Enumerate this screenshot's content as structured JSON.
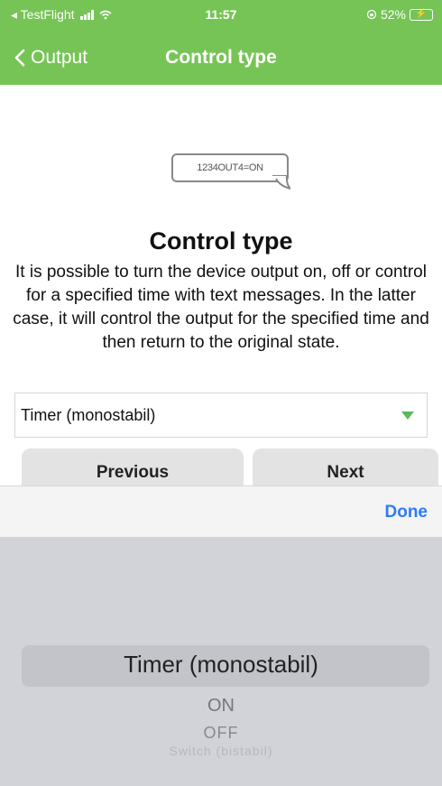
{
  "status": {
    "carrier": "◂ TestFlight",
    "time": "11:57",
    "battery_pct": "52%"
  },
  "nav": {
    "back_label": "Output",
    "title": "Control type"
  },
  "bubble": {
    "text": "1234OUT4=ON"
  },
  "content": {
    "title": "Control type",
    "description": "It is possible to turn the device output on, off or control for a specified time with text messages. In the latter case, it will control the output for the specified time and then return to the original state."
  },
  "select": {
    "value": "Timer (monostabil)"
  },
  "buttons": {
    "previous": "Previous",
    "next": "Next"
  },
  "toolbar": {
    "done": "Done"
  },
  "picker": {
    "options": [
      "Timer (monostabil)",
      "ON",
      "OFF",
      "Switch (bistabil)"
    ],
    "selected": "Timer (monostabil)"
  },
  "colors": {
    "header_green": "#76c456",
    "done_blue": "#2e7bf6",
    "caret_green": "#5cb85c"
  }
}
